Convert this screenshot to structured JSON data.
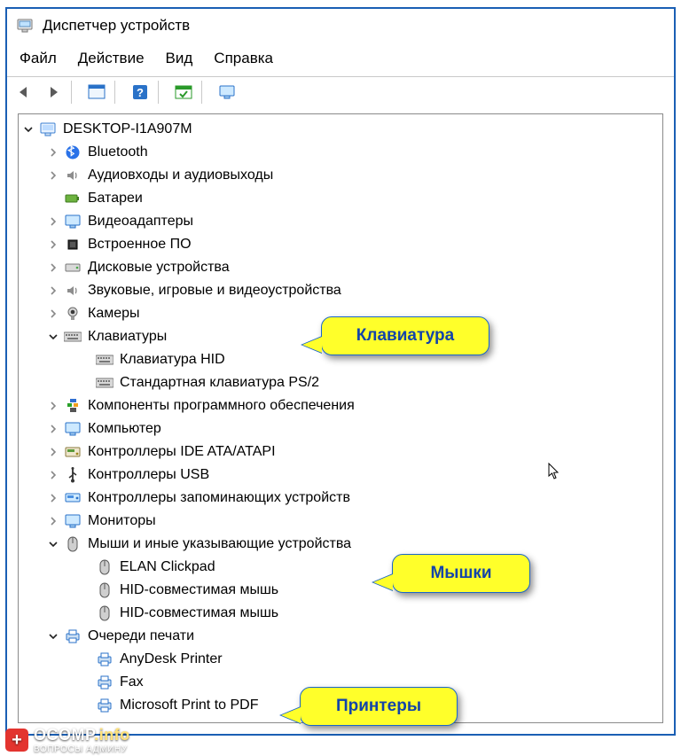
{
  "window": {
    "title": "Диспетчер устройств"
  },
  "menu": {
    "file": "Файл",
    "action": "Действие",
    "view": "Вид",
    "help": "Справка"
  },
  "root": {
    "label": "DESKTOP-I1A907M",
    "expanded": true
  },
  "nodes": [
    {
      "id": "bluetooth",
      "chev": "right",
      "icon": "bluetooth",
      "label": "Bluetooth"
    },
    {
      "id": "audio-io",
      "chev": "right",
      "icon": "speaker",
      "label": "Аудиовходы и аудиовыходы"
    },
    {
      "id": "battery",
      "chev": "none",
      "icon": "battery",
      "label": "Батареи"
    },
    {
      "id": "display-ad",
      "chev": "right",
      "icon": "monitor",
      "label": "Видеоадаптеры"
    },
    {
      "id": "firmware",
      "chev": "right",
      "icon": "chip",
      "label": "Встроенное ПО"
    },
    {
      "id": "disk",
      "chev": "right",
      "icon": "drive",
      "label": "Дисковые устройства"
    },
    {
      "id": "sound",
      "chev": "right",
      "icon": "speaker",
      "label": "Звуковые, игровые и видеоустройства"
    },
    {
      "id": "camera",
      "chev": "right",
      "icon": "camera",
      "label": "Камеры"
    },
    {
      "id": "keyboards",
      "chev": "down",
      "icon": "keyboard",
      "label": "Клавиатуры",
      "children": [
        {
          "id": "kb-hid",
          "icon": "keyboard",
          "label": "Клавиатура HID"
        },
        {
          "id": "kb-ps2",
          "icon": "keyboard",
          "label": "Стандартная клавиатура PS/2"
        }
      ]
    },
    {
      "id": "software",
      "chev": "right",
      "icon": "swcomp",
      "label": "Компоненты программного обеспечения"
    },
    {
      "id": "computer",
      "chev": "right",
      "icon": "monitor",
      "label": "Компьютер"
    },
    {
      "id": "ide",
      "chev": "right",
      "icon": "ide",
      "label": "Контроллеры IDE ATA/ATAPI"
    },
    {
      "id": "usb",
      "chev": "right",
      "icon": "usb",
      "label": "Контроллеры USB"
    },
    {
      "id": "storage",
      "chev": "right",
      "icon": "storage",
      "label": "Контроллеры запоминающих устройств"
    },
    {
      "id": "monitors",
      "chev": "right",
      "icon": "monitor",
      "label": "Мониторы"
    },
    {
      "id": "mice",
      "chev": "down",
      "icon": "mouse",
      "label": "Мыши и иные указывающие устройства",
      "children": [
        {
          "id": "mouse-elan",
          "icon": "mouse",
          "label": "ELAN Clickpad"
        },
        {
          "id": "mouse-hid1",
          "icon": "mouse",
          "label": "HID-совместимая мышь"
        },
        {
          "id": "mouse-hid2",
          "icon": "mouse",
          "label": "HID-совместимая мышь"
        }
      ]
    },
    {
      "id": "printq",
      "chev": "down",
      "icon": "printer",
      "label": "Очереди печати",
      "children": [
        {
          "id": "prn-anydesk",
          "icon": "printer",
          "label": "AnyDesk Printer"
        },
        {
          "id": "prn-fax",
          "icon": "printer",
          "label": "Fax"
        },
        {
          "id": "prn-mspdf",
          "icon": "printer",
          "label": "Microsoft Print to PDF"
        }
      ]
    }
  ],
  "callouts": {
    "keyboard": "Клавиатура",
    "mice": "Мышки",
    "printers": "Принтеры"
  },
  "watermark": {
    "brand": "OCOMP",
    "tld": ".info",
    "tag": "ВОПРОСЫ АДМИНУ"
  }
}
